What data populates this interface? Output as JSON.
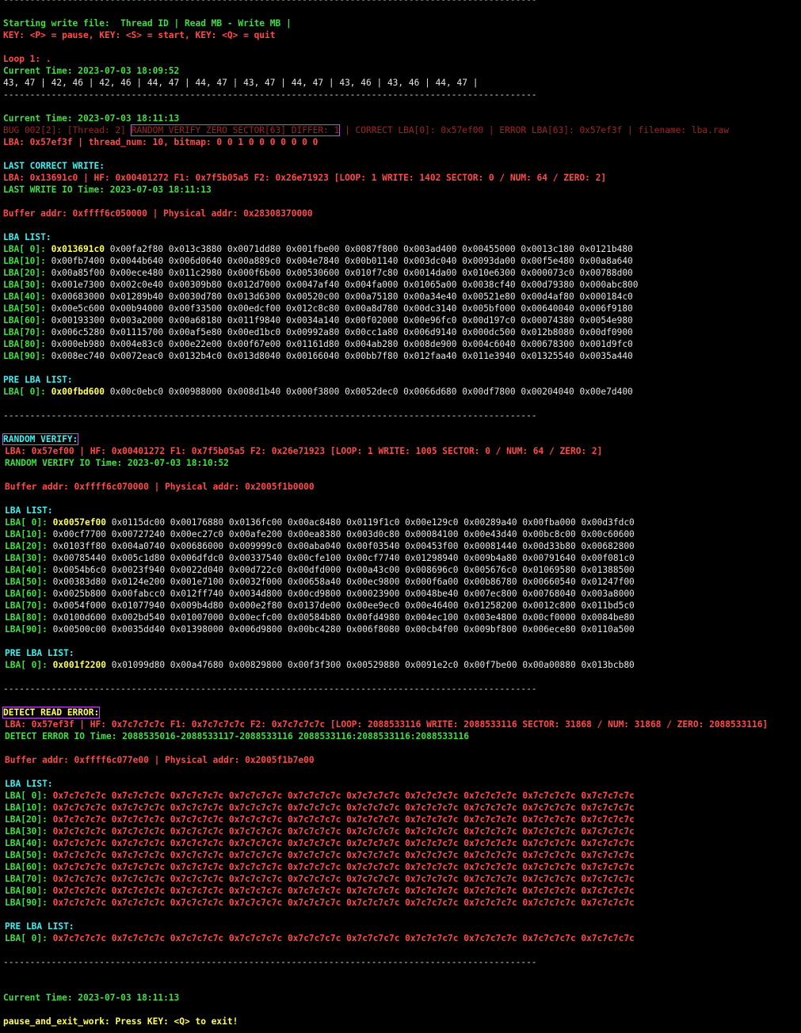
{
  "sep": "----------------------------------------------------------------------------------------------------",
  "header": {
    "start": "Starting write file:  Thread ID | Read MB - Write MB |",
    "keys": "KEY: <P> = pause, KEY: <S> = start, KEY: <Q> = quit"
  },
  "loop": {
    "label": "Loop 1: .",
    "time": "Current Time: 2023-07-03 18:09:52",
    "stats": "43, 47 | 42, 46 | 42, 46 | 44, 47 | 44, 47 | 43, 47 | 44, 47 | 43, 46 | 43, 46 | 44, 47 |"
  },
  "bug": {
    "time": "Current Time: 2023-07-03 18:11:13",
    "prefix": "BUG 002[2]: [Thread: 2] ",
    "boxed": "RANDOM VERIFY ZERO SECTOR[63] DIFFER: 1",
    "suffix": " | CORRECT LBA[0]: 0x57ef00 | ERROR LBA[63]: 0x57ef3f | filename: lba.raw",
    "lba": "LBA: 0x57ef3f | thread_num: 10, bitmap: 0 0 1 0 0 0 0 0 0 0"
  },
  "last_correct": {
    "title": "LAST CORRECT WRITE:",
    "info": "LBA: 0x13691c0 | HF: 0x00401272 F1: 0x7f5b05a5 F2: 0x26e71923 [LOOP: 1 WRITE: 1402 SECTOR: 0 / NUM: 64 / ZERO: 2]",
    "io_time": "LAST WRITE IO Time: 2023-07-03 18:11:13",
    "buffer": "Buffer addr: 0xffff6c050000 | Physical addr: 0x28308370000",
    "lba_list_title": "LBA LIST:",
    "rows": [
      {
        "label": "LBA[ 0]: ",
        "first": "0x013691c0",
        "rest": " 0x00fa2f80 0x013c3880 0x0071dd80 0x001fbe00 0x0087f800 0x003ad400 0x00455000 0x0013c180 0x0121b480"
      },
      {
        "label": "LBA[10]: ",
        "first": "",
        "rest": "0x00fb7400 0x0044b640 0x006d0640 0x00a889c0 0x004e7840 0x00b01140 0x003dc040 0x0093da00 0x00f5e480 0x00a8a640"
      },
      {
        "label": "LBA[20]: ",
        "first": "",
        "rest": "0x00a85f00 0x00ece480 0x011c2980 0x000f6b00 0x00530600 0x010f7c80 0x0014da00 0x010e6300 0x000073c0 0x00788d00"
      },
      {
        "label": "LBA[30]: ",
        "first": "",
        "rest": "0x001e7300 0x002c0e40 0x00309b80 0x012d7000 0x0047af40 0x004fa000 0x01065a00 0x0038cf40 0x00d79380 0x000abc800"
      },
      {
        "label": "LBA[40]: ",
        "first": "",
        "rest": "0x00683000 0x01289b40 0x0030d780 0x013d6300 0x00520c00 0x00a75180 0x00a34e40 0x00521e80 0x00d4af80 0x000184c0"
      },
      {
        "label": "LBA[50]: ",
        "first": "",
        "rest": "0x00e5c600 0x00b94000 0x00f33500 0x00edcf00 0x012c8c80 0x00a8d780 0x00dc3140 0x005bf000 0x00640040 0x006f9180"
      },
      {
        "label": "LBA[60]: ",
        "first": "",
        "rest": "0x00193300 0x003a2000 0x00a68180 0x011f9840 0x0034a140 0x00f02000 0x00e96fc0 0x00d197c0 0x00074380 0x0054e980"
      },
      {
        "label": "LBA[70]: ",
        "first": "",
        "rest": "0x006c5280 0x01115700 0x00af5e80 0x00ed1bc0 0x00992a80 0x00cc1a80 0x006d9140 0x000dc500 0x012b8080 0x00df0900"
      },
      {
        "label": "LBA[80]: ",
        "first": "",
        "rest": "0x000eb980 0x004e83c0 0x00e22e00 0x00f67e00 0x01161d80 0x004ab280 0x008de900 0x004c6040 0x00678300 0x001d9fc0"
      },
      {
        "label": "LBA[90]: ",
        "first": "",
        "rest": "0x008ec740 0x0072eac0 0x0132b4c0 0x013d8040 0x00166040 0x00bb7f80 0x012faa40 0x011e3940 0x01325540 0x0035a440"
      }
    ],
    "pre_title": "PRE LBA LIST:",
    "pre_row": {
      "label": "LBA[ 0]: ",
      "first": "0x00fbd600",
      "rest": " 0x00c0ebc0 0x00988000 0x008d1b40 0x000f3800 0x0052dec0 0x0066d680 0x00df7800 0x00204040 0x00e7d400"
    }
  },
  "random_verify": {
    "title": "RANDOM VERIFY:",
    "info": "LBA: 0x57ef00 | HF: 0x00401272 F1: 0x7f5b05a5 F2: 0x26e71923 [LOOP: 1 WRITE: 1005 SECTOR: 0 / NUM: 64 / ZERO: 2]",
    "io_time": "RANDOM VERIFY IO Time: 2023-07-03 18:10:52",
    "buffer": "Buffer addr: 0xffff6c070000 | Physical addr: 0x2005f1b0000",
    "lba_list_title": "LBA LIST:",
    "rows": [
      {
        "label": "LBA[ 0]: ",
        "first": "0x0057ef00",
        "rest": " 0x0115dc00 0x00176880 0x0136fc00 0x00ac8480 0x0119f1c0 0x00e129c0 0x00289a40 0x00fba000 0x00d3fdc0"
      },
      {
        "label": "LBA[10]: ",
        "first": "",
        "rest": "0x00cf7700 0x00727240 0x00ec27c0 0x00afe200 0x00ea8380 0x003d0c80 0x00084100 0x00e43d40 0x00bc8c00 0x00c60600"
      },
      {
        "label": "LBA[20]: ",
        "first": "",
        "rest": "0x0103ff80 0x004a0740 0x00686000 0x009999c0 0x00aba040 0x00f03540 0x00453f00 0x00081440 0x00d33b80 0x00682800"
      },
      {
        "label": "LBA[30]: ",
        "first": "",
        "rest": "0x00785440 0x005c1d80 0x006dfdc0 0x00337540 0x00cfe100 0x00cf7740 0x01298940 0x009b4a80 0x00791640 0x00f081c0"
      },
      {
        "label": "LBA[40]: ",
        "first": "",
        "rest": "0x0054b6c0 0x0023f940 0x0022d040 0x00d722c0 0x00dfd000 0x00a43c00 0x008696c0 0x005676c0 0x01069580 0x01388500"
      },
      {
        "label": "LBA[50]: ",
        "first": "",
        "rest": "0x00383d80 0x0124e200 0x001e7100 0x0032f000 0x00658a40 0x00ec9800 0x000f6a00 0x00b86780 0x00660540 0x01247f00"
      },
      {
        "label": "LBA[60]: ",
        "first": "",
        "rest": "0x0025b800 0x00fabcc0 0x012ff740 0x0034d800 0x00cd9800 0x00023900 0x0048be40 0x007ec800 0x00768040 0x003a8000"
      },
      {
        "label": "LBA[70]: ",
        "first": "",
        "rest": "0x0054f000 0x01077940 0x009b4d80 0x000e2f80 0x0137de00 0x00ee9ec0 0x00e46400 0x01258200 0x0012c800 0x011bd5c0"
      },
      {
        "label": "LBA[80]: ",
        "first": "",
        "rest": "0x0100d600 0x002bd540 0x01007000 0x00ecfc00 0x00584b80 0x00fd4980 0x004ec100 0x003e4800 0x00cf0000 0x0084be80"
      },
      {
        "label": "LBA[90]: ",
        "first": "",
        "rest": "0x00500c00 0x0035dd40 0x01398000 0x006d9800 0x00bc4280 0x006f8080 0x00cb4f00 0x009bf800 0x006ece80 0x0110a500"
      }
    ],
    "pre_title": "PRE LBA LIST:",
    "pre_row": {
      "label": "LBA[ 0]: ",
      "first": "0x001f2200",
      "rest": " 0x01099d80 0x00a47680 0x00829800 0x00f3f300 0x00529880 0x0091e2c0 0x00f7be00 0x00a00880 0x013bcb80"
    }
  },
  "detect": {
    "title": "DETECT READ ERROR:",
    "info": "LBA: 0x57ef3f | HF: 0x7c7c7c7c F1: 0x7c7c7c7c F2: 0x7c7c7c7c [LOOP: 2088533116 WRITE: 2088533116 SECTOR: 31868 / NUM: 31868 / ZERO: 2088533116]",
    "io_time": "DETECT ERROR IO Time: 2088535016-2088533117-2088533116 2088533116:2088533116:2088533116",
    "buffer": "Buffer addr: 0xffff6c077e00 | Physical addr: 0x2005f1b7e00",
    "lba_list_title": "LBA LIST:",
    "row_value": "0x7c7c7c7c 0x7c7c7c7c 0x7c7c7c7c 0x7c7c7c7c 0x7c7c7c7c 0x7c7c7c7c 0x7c7c7c7c 0x7c7c7c7c 0x7c7c7c7c 0x7c7c7c7c",
    "row_labels": [
      "LBA[ 0]: ",
      "LBA[10]: ",
      "LBA[20]: ",
      "LBA[30]: ",
      "LBA[40]: ",
      "LBA[50]: ",
      "LBA[60]: ",
      "LBA[70]: ",
      "LBA[80]: ",
      "LBA[90]: "
    ],
    "pre_title": "PRE LBA LIST:",
    "pre_label": "LBA[ 0]: "
  },
  "footer": {
    "time": "Current Time: 2023-07-03 18:11:13",
    "exit": "pause_and_exit_work: Press KEY: <Q> to exit!"
  }
}
